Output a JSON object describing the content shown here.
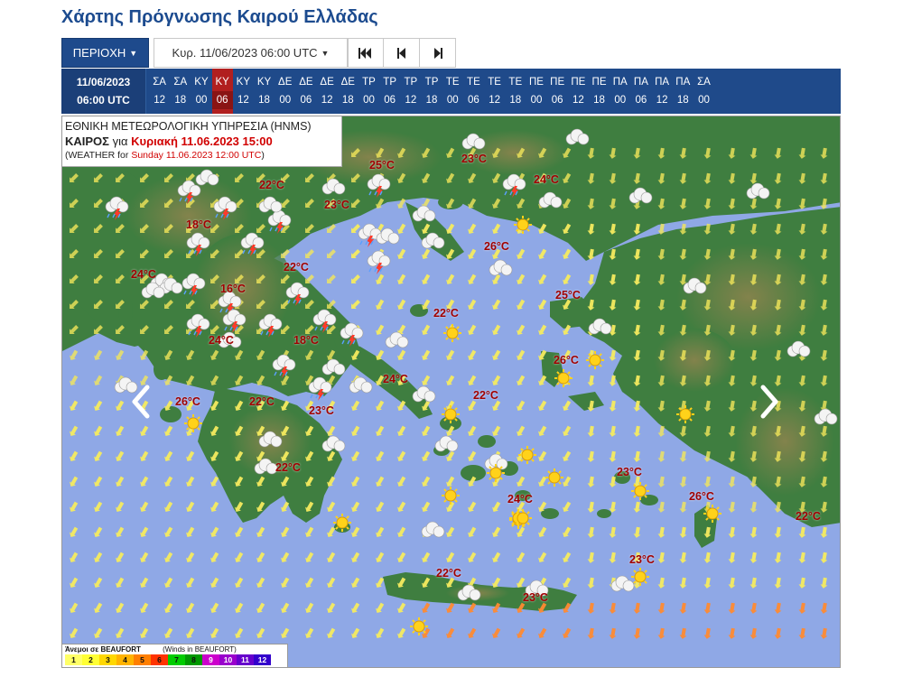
{
  "page": {
    "title": "Χάρτης Πρόγνωσης Καιρού Ελλάδας"
  },
  "toolbar": {
    "region_label": "ΠΕΡΙΟΧΗ",
    "date_selected": "Κυρ. 11/06/2023 06:00 UTC",
    "first_icon": "skip-to-first-icon",
    "prev_icon": "step-back-icon",
    "next_icon": "step-forward-icon"
  },
  "timeline": {
    "current_date": "11/06/2023",
    "current_time": "06:00 UTC",
    "active_index": 3,
    "steps": [
      {
        "d": "ΣΑ",
        "h": "12"
      },
      {
        "d": "ΣΑ",
        "h": "18"
      },
      {
        "d": "ΚΥ",
        "h": "00"
      },
      {
        "d": "ΚΥ",
        "h": "06"
      },
      {
        "d": "ΚΥ",
        "h": "12"
      },
      {
        "d": "ΚΥ",
        "h": "18"
      },
      {
        "d": "ΔΕ",
        "h": "00"
      },
      {
        "d": "ΔΕ",
        "h": "06"
      },
      {
        "d": "ΔΕ",
        "h": "12"
      },
      {
        "d": "ΔΕ",
        "h": "18"
      },
      {
        "d": "ΤΡ",
        "h": "00"
      },
      {
        "d": "ΤΡ",
        "h": "06"
      },
      {
        "d": "ΤΡ",
        "h": "12"
      },
      {
        "d": "ΤΡ",
        "h": "18"
      },
      {
        "d": "ΤΕ",
        "h": "00"
      },
      {
        "d": "ΤΕ",
        "h": "06"
      },
      {
        "d": "ΤΕ",
        "h": "12"
      },
      {
        "d": "ΤΕ",
        "h": "18"
      },
      {
        "d": "ΠΕ",
        "h": "00"
      },
      {
        "d": "ΠΕ",
        "h": "06"
      },
      {
        "d": "ΠΕ",
        "h": "12"
      },
      {
        "d": "ΠΕ",
        "h": "18"
      },
      {
        "d": "ΠΑ",
        "h": "00"
      },
      {
        "d": "ΠΑ",
        "h": "06"
      },
      {
        "d": "ΠΑ",
        "h": "12"
      },
      {
        "d": "ΠΑ",
        "h": "18"
      },
      {
        "d": "ΣΑ",
        "h": "00"
      }
    ]
  },
  "info": {
    "agency": "ΕΘΝΙΚΗ ΜΕΤΕΩΡΟΛΟΓΙΚΗ ΥΠΗΡΕΣΙΑ (HNMS)",
    "weather_label": "ΚΑΙΡΟΣ",
    "weather_for": "για",
    "weather_date": "Κυριακή 11.06.2023 15:00",
    "english_prefix": "(WEATHER for",
    "english_date": "Sunday 11.06.2023 12:00 UTC",
    "english_suffix": ")"
  },
  "colors": {
    "sea": "#8fa8e6",
    "land": "#3f7e40",
    "mountain": "#8a7a4a",
    "temp_text": "#a00000",
    "accent": "#1e4a8c"
  },
  "temperatures": [
    "25°C",
    "23°C",
    "24°C",
    "22°C",
    "23°C",
    "18°C",
    "26°C",
    "24°C",
    "22°C",
    "16°C",
    "25°C",
    "22°C",
    "24°C",
    "18°C",
    "26°C",
    "24°C",
    "26°C",
    "22°C",
    "22°C",
    "23°C",
    "22°C",
    "23°C",
    "24°C",
    "26°C",
    "22°C",
    "23°C",
    "22°C",
    "23°C"
  ],
  "weather_icons": [
    "sun-icon",
    "cloud-icon",
    "storm-icon",
    "rain-icon"
  ],
  "legend": {
    "title": "Άνεμοι σε BEAUFORT",
    "subtitle": "(Winds in BEAUFORT)",
    "scale": [
      {
        "v": "1",
        "c": "#ffff66"
      },
      {
        "v": "2",
        "c": "#ffff33"
      },
      {
        "v": "3",
        "c": "#ffd700"
      },
      {
        "v": "4",
        "c": "#ffb300"
      },
      {
        "v": "5",
        "c": "#ff7f00"
      },
      {
        "v": "6",
        "c": "#ff3300"
      },
      {
        "v": "7",
        "c": "#00cc00"
      },
      {
        "v": "8",
        "c": "#009900"
      },
      {
        "v": "9",
        "c": "#cc00cc"
      },
      {
        "v": "10",
        "c": "#9900cc"
      },
      {
        "v": "11",
        "c": "#6600cc"
      },
      {
        "v": "12",
        "c": "#3300cc"
      }
    ]
  }
}
